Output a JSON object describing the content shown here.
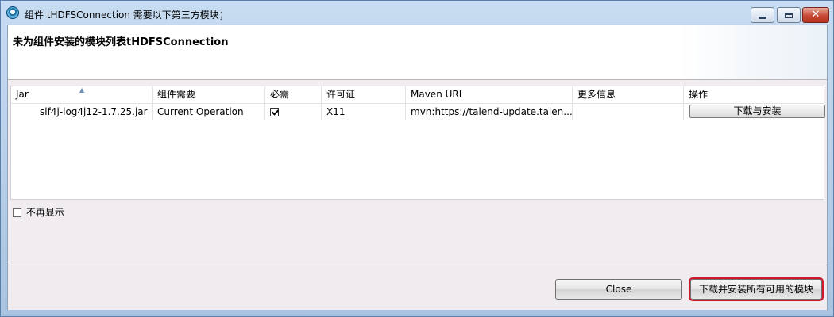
{
  "window": {
    "title": "组件 tHDFSConnection 需要以下第三方模块；",
    "app_icon": "talend-studio-icon"
  },
  "header": {
    "title": "未为组件安装的模块列表tHDFSConnection"
  },
  "table": {
    "columns": [
      "Jar",
      "组件需要",
      "必需",
      "许可证",
      "Maven URI",
      "更多信息",
      "操作"
    ],
    "sorted_column": "Jar",
    "rows": [
      {
        "jar": "slf4j-log4j12-1.7.25.jar",
        "required_by": "Current Operation",
        "required": true,
        "license": "X11",
        "maven_uri": "mvn:https://talend-update.talen...",
        "more_info": "",
        "action_label": "下载与安装"
      }
    ]
  },
  "options": {
    "dont_show_label": "不再显示",
    "dont_show_checked": false
  },
  "footer": {
    "close_label": "Close",
    "install_all_label": "下载并安装所有可用的模块"
  },
  "colors": {
    "highlight": "#d0182a",
    "titlebar": "#bcd3ea"
  }
}
